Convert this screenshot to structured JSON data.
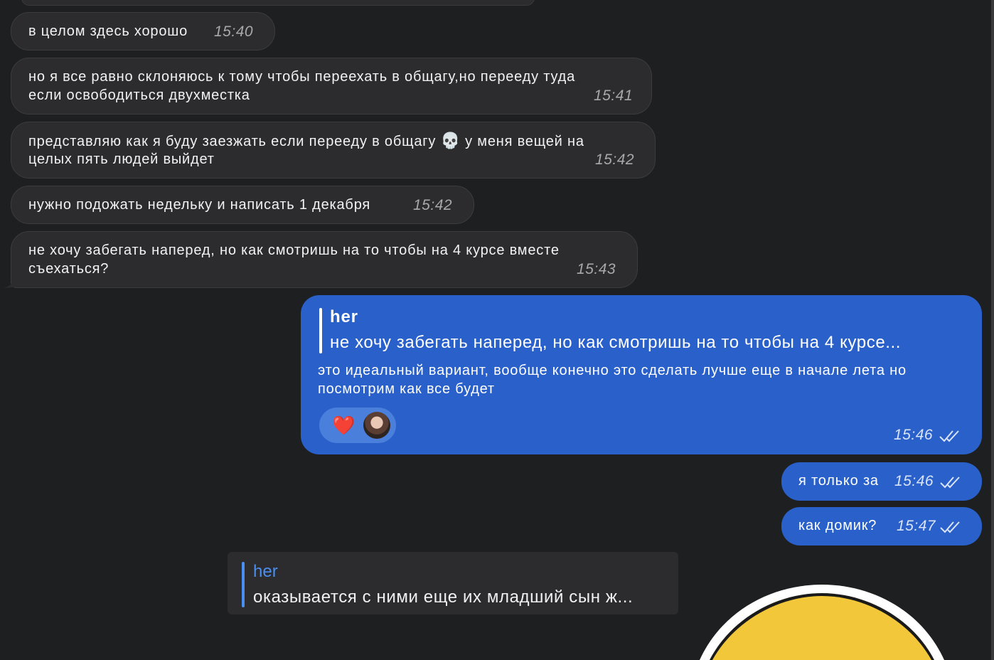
{
  "messages_incoming": [
    {
      "text": "в целом здесь хорошо",
      "time": "15:40"
    },
    {
      "line1": "но я все равно склоняюсь к тому чтобы переехать в общагу,но перееду туда",
      "line2": "если освободиться двухместка",
      "time": "15:41"
    },
    {
      "line1_a": "представляю как я буду заезжать если перееду в общагу",
      "emoji": "💀",
      "line1_b": "у меня вещей на",
      "line2": "целых пять людей выйдет",
      "time": "15:42"
    },
    {
      "text": "нужно подожать недельку и написать 1 декабря",
      "time": "15:42"
    },
    {
      "line1": "не хочу забегать наперед, но как смотришь на то чтобы на 4 курсе вместе",
      "line2": "съехаться?",
      "time": "15:43"
    }
  ],
  "reply_message": {
    "quote_name": "her",
    "quote_text": "не хочу забегать наперед, но как смотришь на то чтобы на 4 курсе...",
    "line1": "это идеальный вариант, вообще конечно это сделать лучше еще в начале лета но",
    "line2": "посмотрим как все будет",
    "reaction_emoji": "❤️",
    "time": "15:46"
  },
  "messages_outgoing": [
    {
      "text": "я только за",
      "time": "15:46"
    },
    {
      "text": "как домик?",
      "time": "15:47"
    }
  ],
  "bottom_reply": {
    "quote_name": "her",
    "quote_text": "оказывается с ними еще их младший сын ж..."
  },
  "colors": {
    "background": "#1e1f20",
    "incoming_bubble": "#2c2c2e",
    "outgoing_bubble": "#2a60c9",
    "reply_name_blue": "#4a8ef0",
    "sticker_yellow": "#f2c73a"
  },
  "icons": {
    "read_receipt": "double-check-icon",
    "sticker": "smiley-sticker"
  }
}
